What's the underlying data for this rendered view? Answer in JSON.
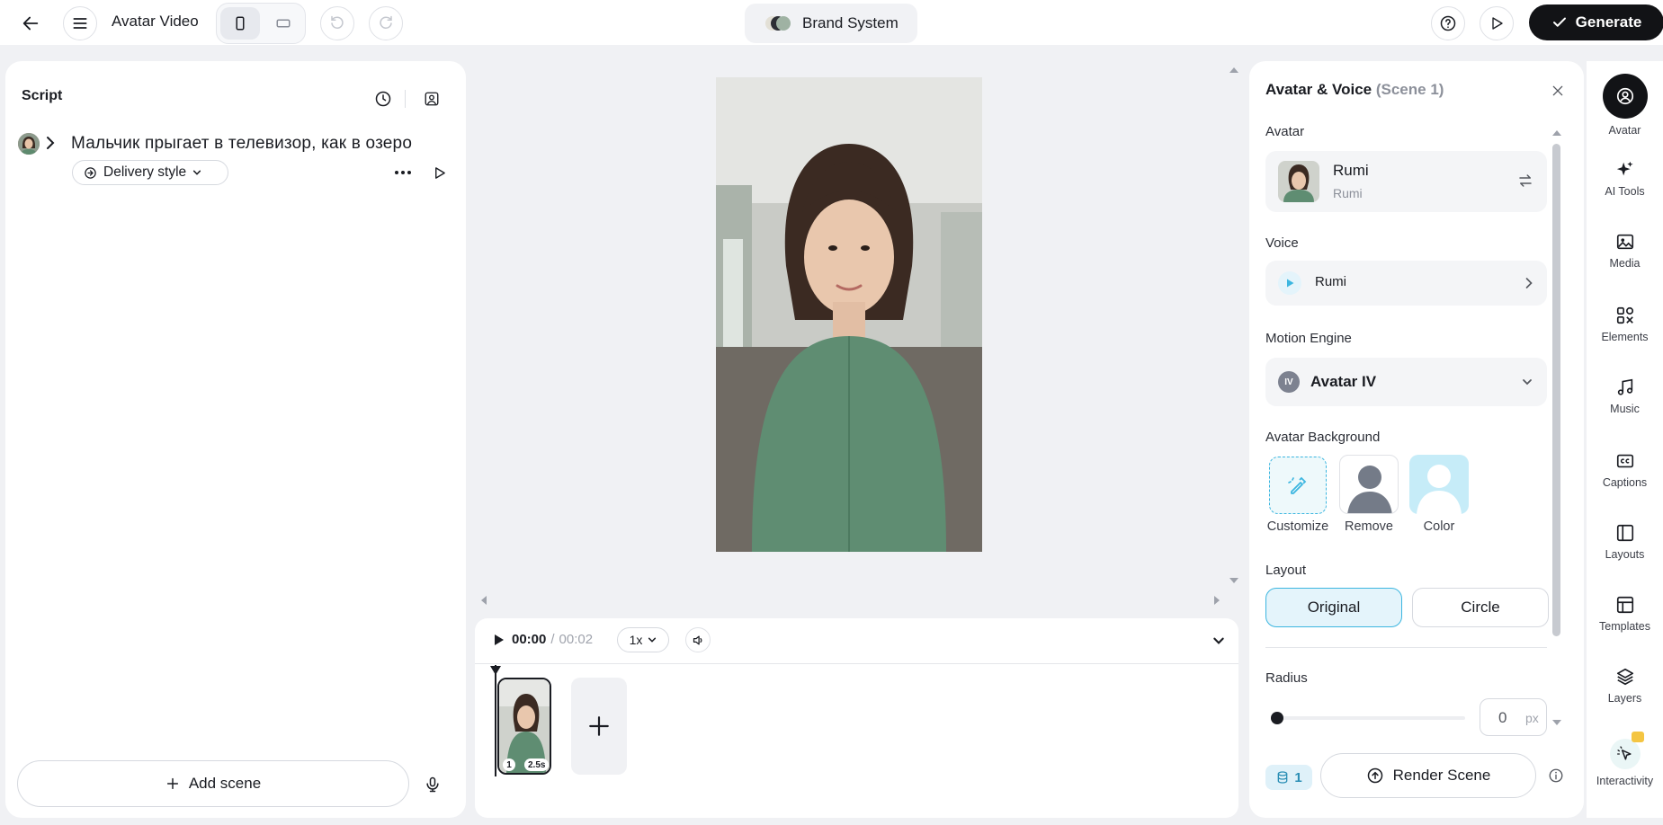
{
  "topbar": {
    "title": "Avatar Video",
    "brand_label": "Brand System",
    "generate_label": "Generate"
  },
  "script": {
    "title": "Script",
    "line_text": "Мальчик прыгает в телевизор, как в озеро",
    "delivery_style_label": "Delivery style",
    "add_scene_label": "Add scene"
  },
  "player": {
    "time_current": "00:00",
    "time_separator": "/",
    "time_total": "00:02",
    "speed": "1x",
    "scene_number": "1",
    "scene_duration": "2.5s"
  },
  "settings": {
    "title": "Avatar & Voice",
    "title_scene": "(Scene 1)",
    "avatar_section": "Avatar",
    "avatar_name": "Rumi",
    "avatar_sub": "Rumi",
    "voice_section": "Voice",
    "voice_name": "Rumi",
    "motion_section": "Motion Engine",
    "motion_badge": "IV",
    "motion_value": "Avatar IV",
    "background_section": "Avatar Background",
    "bg_options": [
      "Customize",
      "Remove",
      "Color"
    ],
    "layout_section": "Layout",
    "layout_options": [
      "Original",
      "Circle"
    ],
    "layout_selected": "Original",
    "radius_section": "Radius",
    "radius_value": "0",
    "radius_unit": "px",
    "radius_level": 0,
    "credits": "1",
    "render_label": "Render Scene"
  },
  "rail": {
    "items": [
      "Avatar",
      "AI Tools",
      "Media",
      "Elements",
      "Music",
      "Captions",
      "Layouts",
      "Templates",
      "Layers",
      "Interactivity"
    ],
    "active": "Avatar"
  },
  "colors": {
    "accent": "#3cb6e0",
    "accent_bg": "#e4f4fb",
    "dark": "#121316",
    "video_bg": "#7a8b80"
  }
}
